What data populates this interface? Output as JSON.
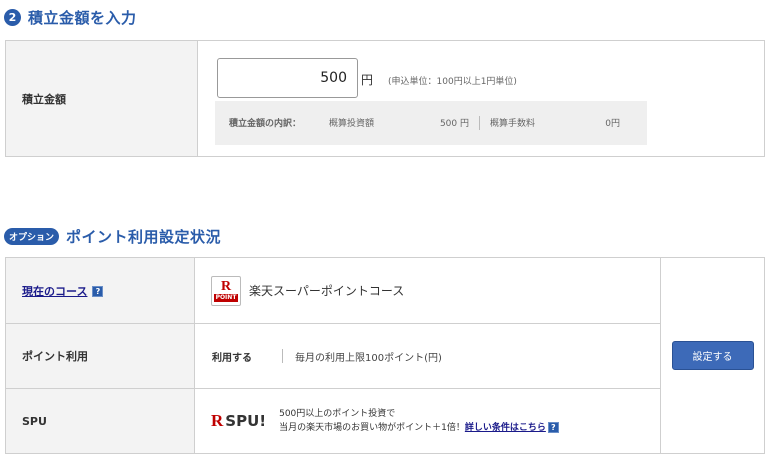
{
  "section1": {
    "step_number": "2",
    "title": "積立金額を入力",
    "row_label": "積立金額",
    "amount_value": "500",
    "currency": "円",
    "note": "(申込単位：100円以上1円単位)",
    "breakdown": {
      "label": "積立金額の内訳：",
      "invest_label": "概算投資額",
      "invest_value": "500 円",
      "fee_label": "概算手数料",
      "fee_value": "0円"
    }
  },
  "section2": {
    "badge": "オプション",
    "title": "ポイント利用設定状況",
    "course_label": "現在のコース",
    "help_glyph": "?",
    "course_logo_r": "R",
    "course_logo_point": "POINT",
    "course_name": "楽天スーパーポイントコース",
    "use_label": "ポイント利用",
    "use_status": "利用する",
    "use_limit": "毎月の利用上限100ポイント(円)",
    "settings_button": "設定する",
    "spu_label": "SPU",
    "spu_logo_r": "R",
    "spu_logo_text": "SPU!",
    "spu_line1": "500円以上のポイント投資で",
    "spu_line2": "当月の楽天市場のお買い物がポイント＋1倍！",
    "spu_link": "詳しい条件はこちら"
  }
}
